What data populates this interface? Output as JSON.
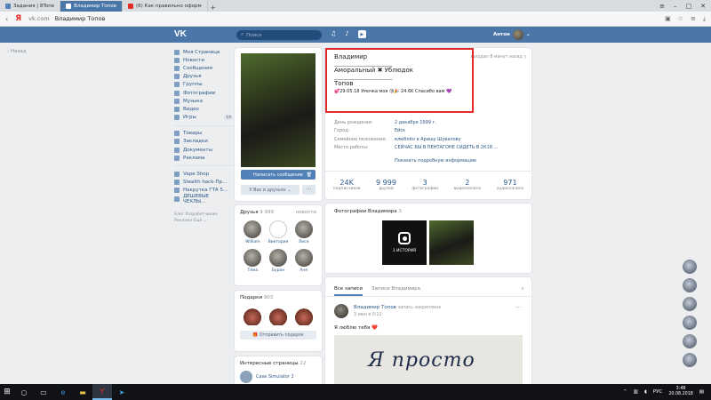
{
  "browser": {
    "tabs": [
      {
        "label": "Задания | 8Tone",
        "icon": "vk-icon",
        "active": false
      },
      {
        "label": "Владимир Топов",
        "icon": "vk-icon",
        "active": true
      },
      {
        "label": "(6) Как правильно оформ",
        "icon": "youtube-icon",
        "active": false
      }
    ],
    "new_tab": "+",
    "address_domain": "vk.com",
    "address_title": "Владимир Топов"
  },
  "header": {
    "logo": "VK",
    "search_placeholder": "Поиск",
    "user_name": "Антон"
  },
  "back_label": "Назад",
  "sidebar": {
    "items": [
      {
        "label": "Моя Страница",
        "count": ""
      },
      {
        "label": "Новости",
        "count": ""
      },
      {
        "label": "Сообщения",
        "count": ""
      },
      {
        "label": "Друзья",
        "count": ""
      },
      {
        "label": "Группы",
        "count": ""
      },
      {
        "label": "Фотографии",
        "count": ""
      },
      {
        "label": "Музыка",
        "count": ""
      },
      {
        "label": "Видео",
        "count": ""
      },
      {
        "label": "Игры",
        "count": "19"
      }
    ],
    "items2": [
      {
        "label": "Товары"
      },
      {
        "label": "Закладки"
      },
      {
        "label": "Документы"
      },
      {
        "label": "Реклама"
      }
    ],
    "items3": [
      {
        "label": "Vape Shop"
      },
      {
        "label": "Stealth hack-Пр..."
      },
      {
        "label": "Накрутка ГТА 5..."
      },
      {
        "label": "ДЕШЕВЫЕ ЧЕХЛЫ..."
      }
    ],
    "footer1": "Блог   Разработчикам",
    "footer2": "Реклама   Ещё ⌄"
  },
  "profile": {
    "name_line1": "Владимир",
    "dashes": "__________________________",
    "name_line2": "Аморальный ✖ Ублюдок",
    "name_line3": "Топов",
    "status": "💕29.05.18 Умочка моя 😘🎉 24.6K Спасибо вам 💜",
    "online": "заходил 8 минут назад",
    "info": [
      {
        "key": "День рождения:",
        "value": "2 декабря 1999 г."
      },
      {
        "key": "Город:",
        "value": "Ейск"
      },
      {
        "key": "Семейное положение:",
        "value": "влюблён в Аришу Шувалову"
      },
      {
        "key": "Место работы:",
        "value": "СЕЙЧАС БЫ В ПЕНТАГОНЕ СИДЕТЬ В 2К18 ..."
      }
    ],
    "show_more": "Показать подробную информацию",
    "counters": [
      {
        "num": "24K",
        "label": "подписчиков"
      },
      {
        "num": "9 999",
        "label": "друзей"
      },
      {
        "num": "3",
        "label": "фотографии"
      },
      {
        "num": "2",
        "label": "видеозаписи"
      },
      {
        "num": "971",
        "label": "аудиозаписи"
      }
    ],
    "btn_message": "Написать сообщение",
    "btn_friends": "У Вас в друзьях ⌄",
    "btn_more": "···"
  },
  "friends": {
    "title": "Друзья",
    "count": "9 999",
    "updates": "новости",
    "list": [
      "William",
      "Виктория",
      "Лися",
      "Тёма",
      "Буран",
      "Аня"
    ]
  },
  "gifts": {
    "title": "Подарки",
    "count": "903",
    "send": "Отправить подарок"
  },
  "interesting": {
    "title": "Интересные страницы",
    "count": "22",
    "item": "Case Simulator 2"
  },
  "photos": {
    "title": "Фотографии Владимира",
    "count": "3",
    "story": "1 ИСТОРИЯ"
  },
  "wall": {
    "tab_all": "Все записи",
    "tab_own": "Записи Владимира",
    "post_author": "Владимир Топов",
    "post_pinned": "запись закреплена",
    "post_date": "3 июн в 0:22",
    "post_text": "Я люблю тебя",
    "post_heart": "❤️",
    "post_image_text": "Я просто"
  },
  "taskbar": {
    "lang": "РУС",
    "time": "3:48",
    "date": "20.08.2018"
  },
  "colors": {
    "vk_blue": "#4a76a8",
    "highlight_red": "#e32b2b"
  }
}
